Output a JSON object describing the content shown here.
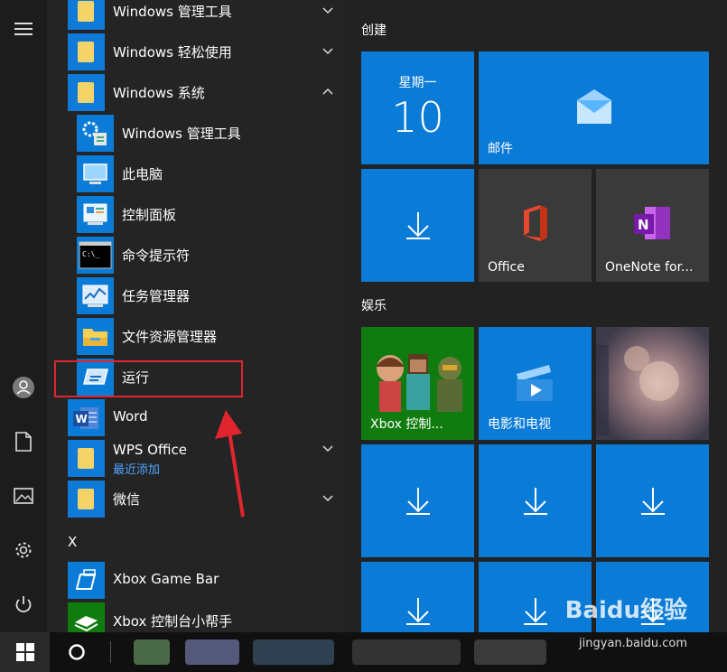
{
  "app_list": {
    "items": [
      {
        "label": "Windows 管理工具",
        "type": "folder",
        "chevron": "down"
      },
      {
        "label": "Windows 轻松使用",
        "type": "folder",
        "chevron": "down"
      },
      {
        "label": "Windows 系统",
        "type": "folder",
        "chevron": "up"
      },
      {
        "label": "Windows 管理工具",
        "type": "app",
        "icon": "admin-tools-icon"
      },
      {
        "label": "此电脑",
        "type": "app",
        "icon": "this-pc-icon"
      },
      {
        "label": "控制面板",
        "type": "app",
        "icon": "control-panel-icon"
      },
      {
        "label": "命令提示符",
        "type": "app",
        "icon": "cmd-icon"
      },
      {
        "label": "任务管理器",
        "type": "app",
        "icon": "task-manager-icon"
      },
      {
        "label": "文件资源管理器",
        "type": "app",
        "icon": "file-explorer-icon"
      },
      {
        "label": "运行",
        "type": "app",
        "icon": "run-icon"
      },
      {
        "label": "Word",
        "type": "app",
        "icon": "word-icon"
      },
      {
        "label": "WPS Office",
        "sublabel": "最近添加",
        "type": "folder",
        "chevron": "down"
      },
      {
        "label": "微信",
        "type": "folder",
        "chevron": "down"
      }
    ],
    "section_letter": "X",
    "x_items": [
      {
        "label": "Xbox Game Bar",
        "icon": "xbox-game-bar-icon"
      },
      {
        "label": "Xbox 控制台小帮手",
        "icon": "xbox-companion-icon"
      }
    ]
  },
  "tiles": {
    "group_create": "创建",
    "group_entertainment": "娱乐",
    "calendar": {
      "weekday": "星期一",
      "day": "10"
    },
    "mail_label": "邮件",
    "office_label": "Office",
    "onenote_label": "OneNote for...",
    "xbox_label": "Xbox 控制...",
    "movies_label": "电影和电视"
  },
  "watermark": {
    "text": "Baidu经验",
    "url": "jingyan.baidu.com"
  },
  "colors": {
    "tile_blue": "#0a7bd6",
    "highlight_red": "#e0252e",
    "arrow_red": "#e0252e",
    "xbox_green": "#107c10"
  }
}
